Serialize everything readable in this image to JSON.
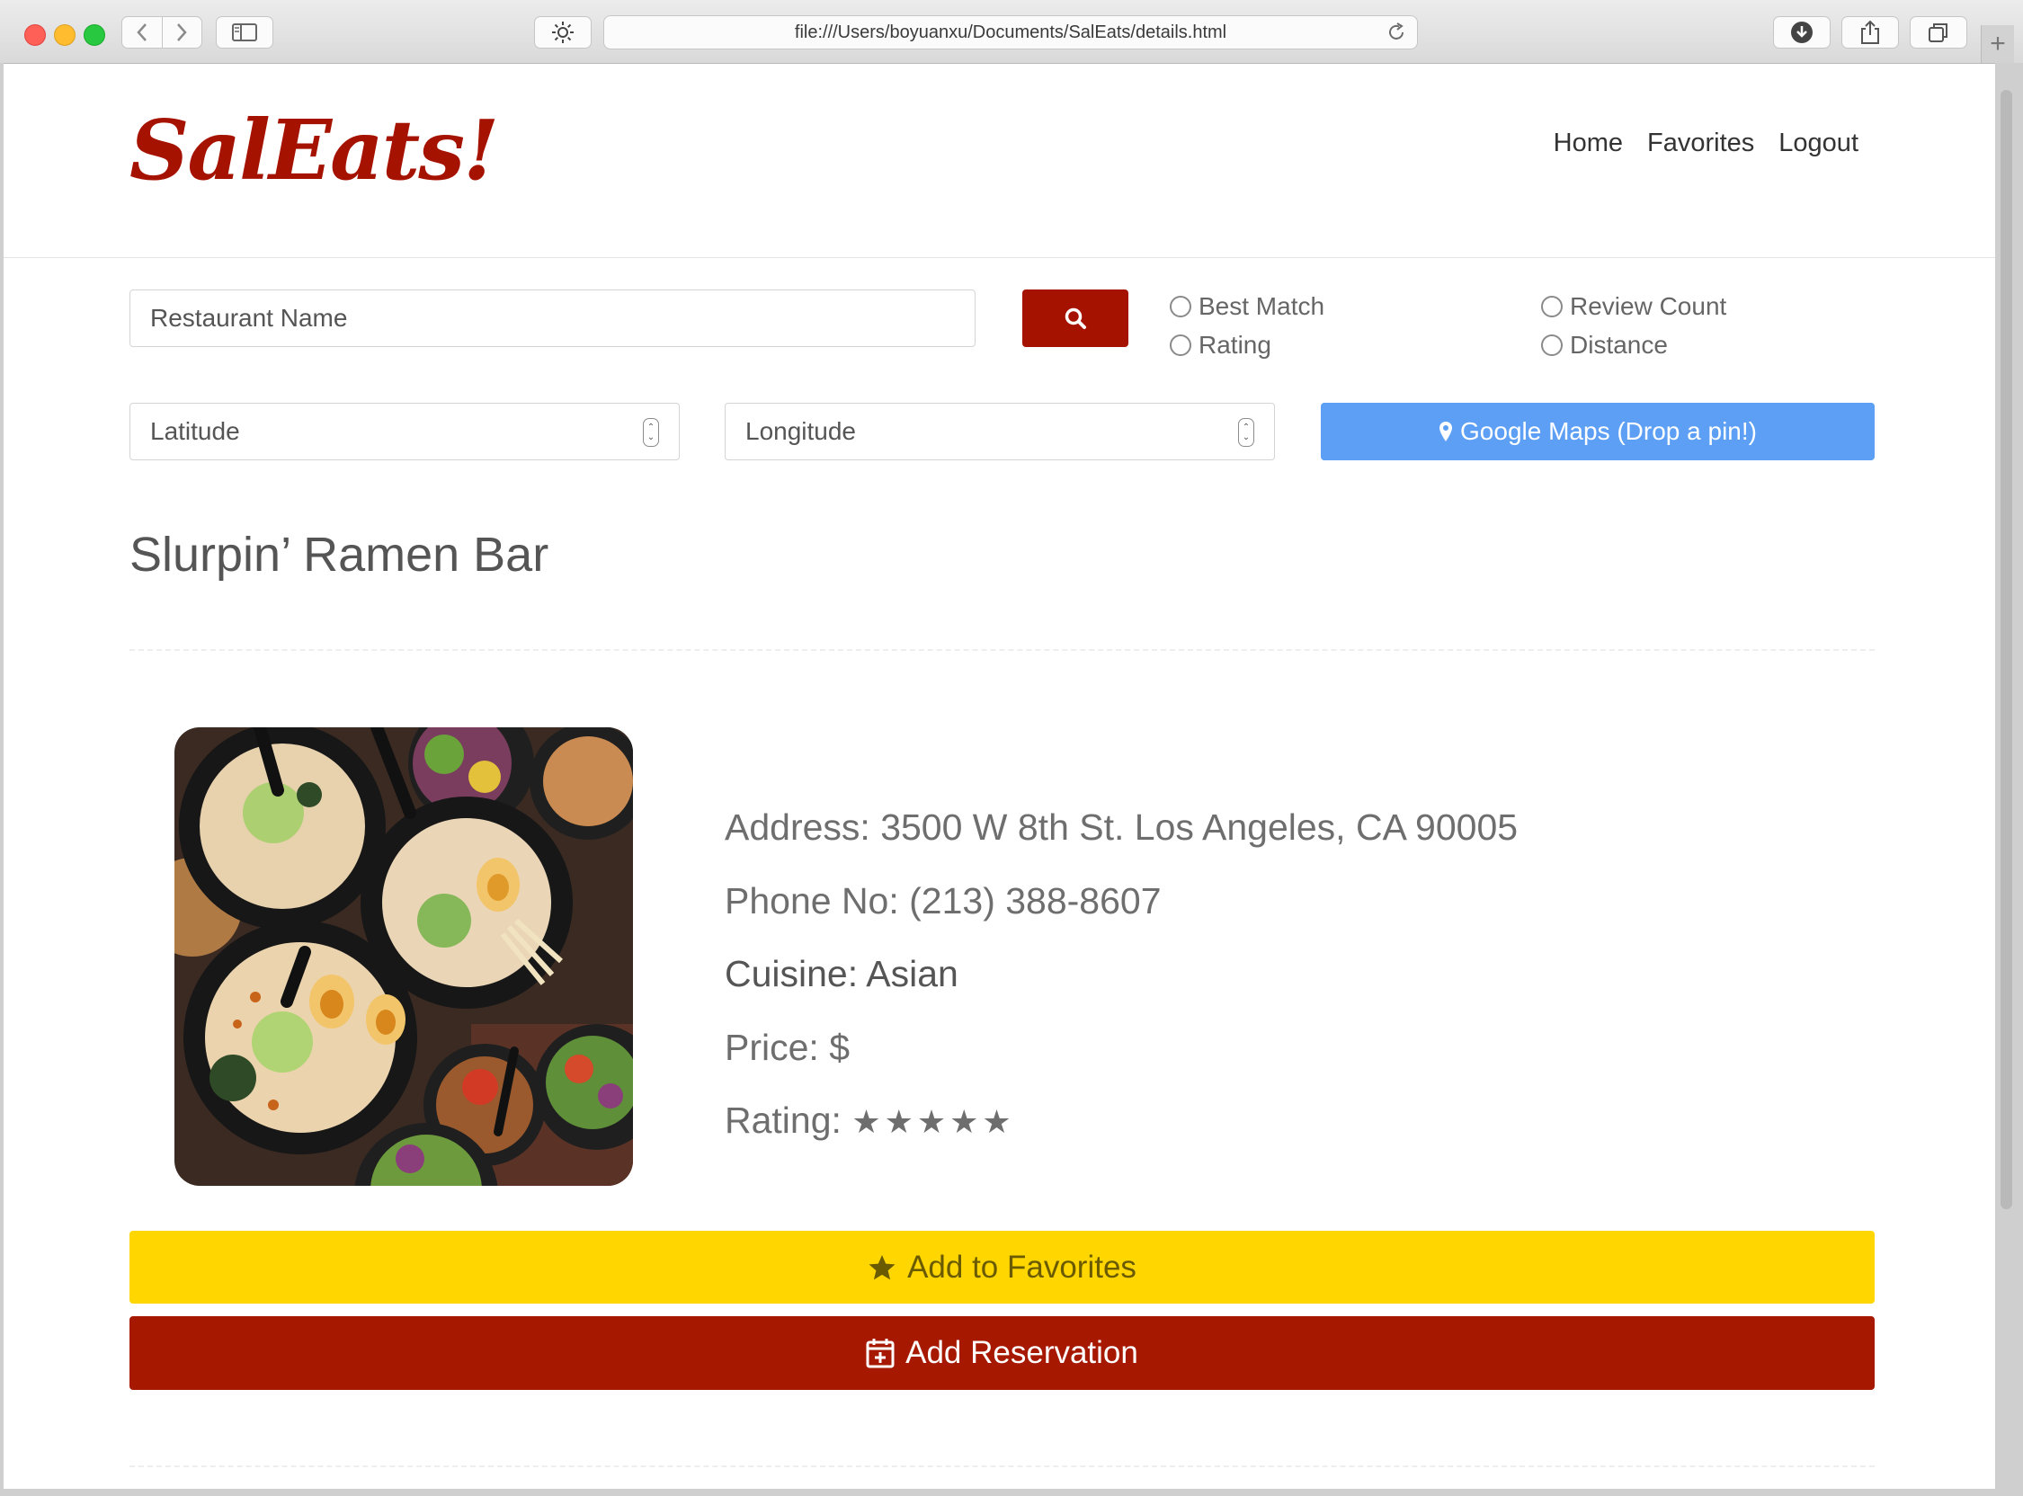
{
  "browser": {
    "url": "file:///Users/boyuanxu/Documents/SalEats/details.html"
  },
  "header": {
    "logo": "SalEats!",
    "nav": [
      "Home",
      "Favorites",
      "Logout"
    ]
  },
  "search": {
    "name_placeholder": "Restaurant Name",
    "sort_options": [
      "Best Match",
      "Review Count",
      "Rating",
      "Distance"
    ],
    "latitude_placeholder": "Latitude",
    "longitude_placeholder": "Longitude",
    "maps_button_label": "Google Maps (Drop a pin!)"
  },
  "restaurant": {
    "name": "Slurpin’ Ramen Bar",
    "address": "Address: 3500 W 8th St. Los Angeles, CA 90005",
    "phone": "Phone No: (213) 388-8607",
    "cuisine": "Cuisine: Asian",
    "price": "Price: $",
    "rating_label": "Rating:",
    "rating_stars": "★★★★★",
    "rating_value": 5
  },
  "actions": {
    "favorites_label": "Add to Favorites",
    "reservation_label": "Add Reservation"
  },
  "colors": {
    "brand_red": "#a61200",
    "favorites_yellow": "#ffd600",
    "maps_blue": "#5c9ff5"
  }
}
